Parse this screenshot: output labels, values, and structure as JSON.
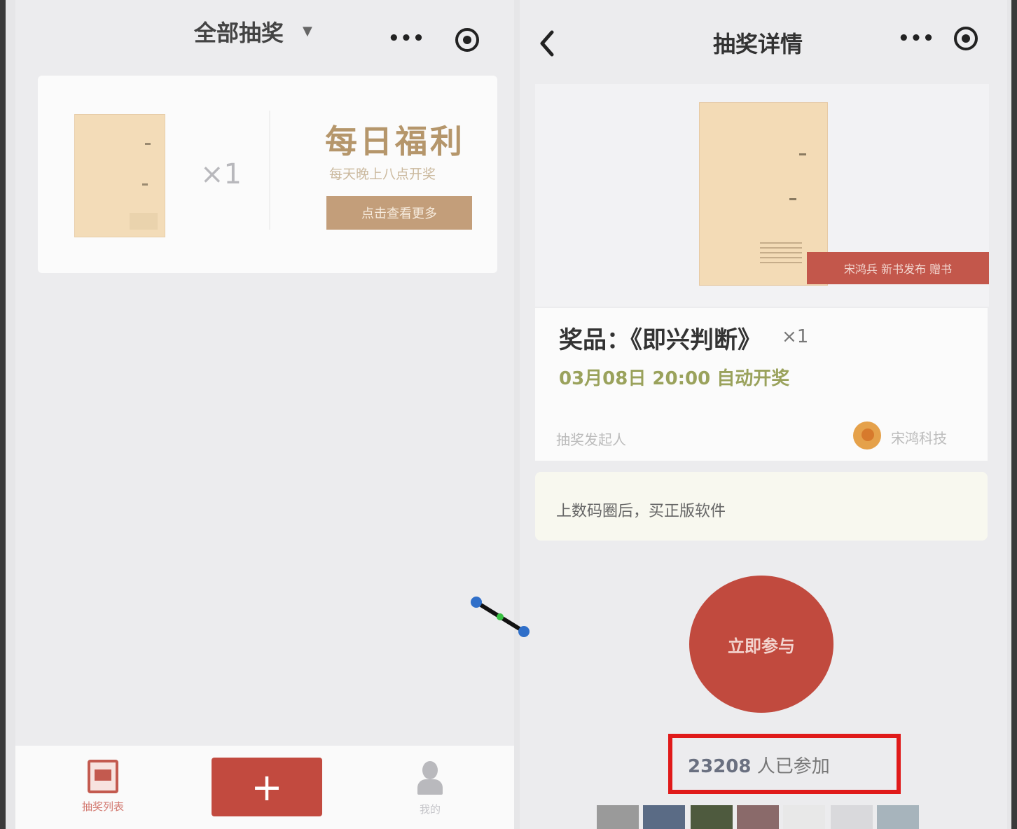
{
  "left_screen": {
    "nav": {
      "title": "全部抽奖",
      "caret": "▼",
      "menu_dots": "•••"
    },
    "promo": {
      "multiplier": "×1",
      "title": "每日福利",
      "subtitle": "每天晚上八点开奖",
      "button": "点击查看更多"
    },
    "tabbar": {
      "home_label": "抽奖列表",
      "add_label": "+",
      "me_label": "我的"
    },
    "accent_color": "#c24a3f"
  },
  "right_screen": {
    "nav": {
      "title": "抽奖详情",
      "menu_dots": "•••"
    },
    "prize_tag": "宋鸿兵 新书发布 赠书",
    "prize": {
      "name": "奖品：《即兴判断》",
      "qty": "×1",
      "draw_time": "03月08日 20:00 自动开奖"
    },
    "sponsor": {
      "label": "抽奖发起人",
      "name": "宋鸿科技"
    },
    "notice": "上数码圈后，买正版软件",
    "join_button": "立即参与",
    "participants": {
      "count": "23208",
      "suffix": "人已参加"
    },
    "highlight_color": "#e01a1a",
    "accent_color": "#c14a3e"
  }
}
